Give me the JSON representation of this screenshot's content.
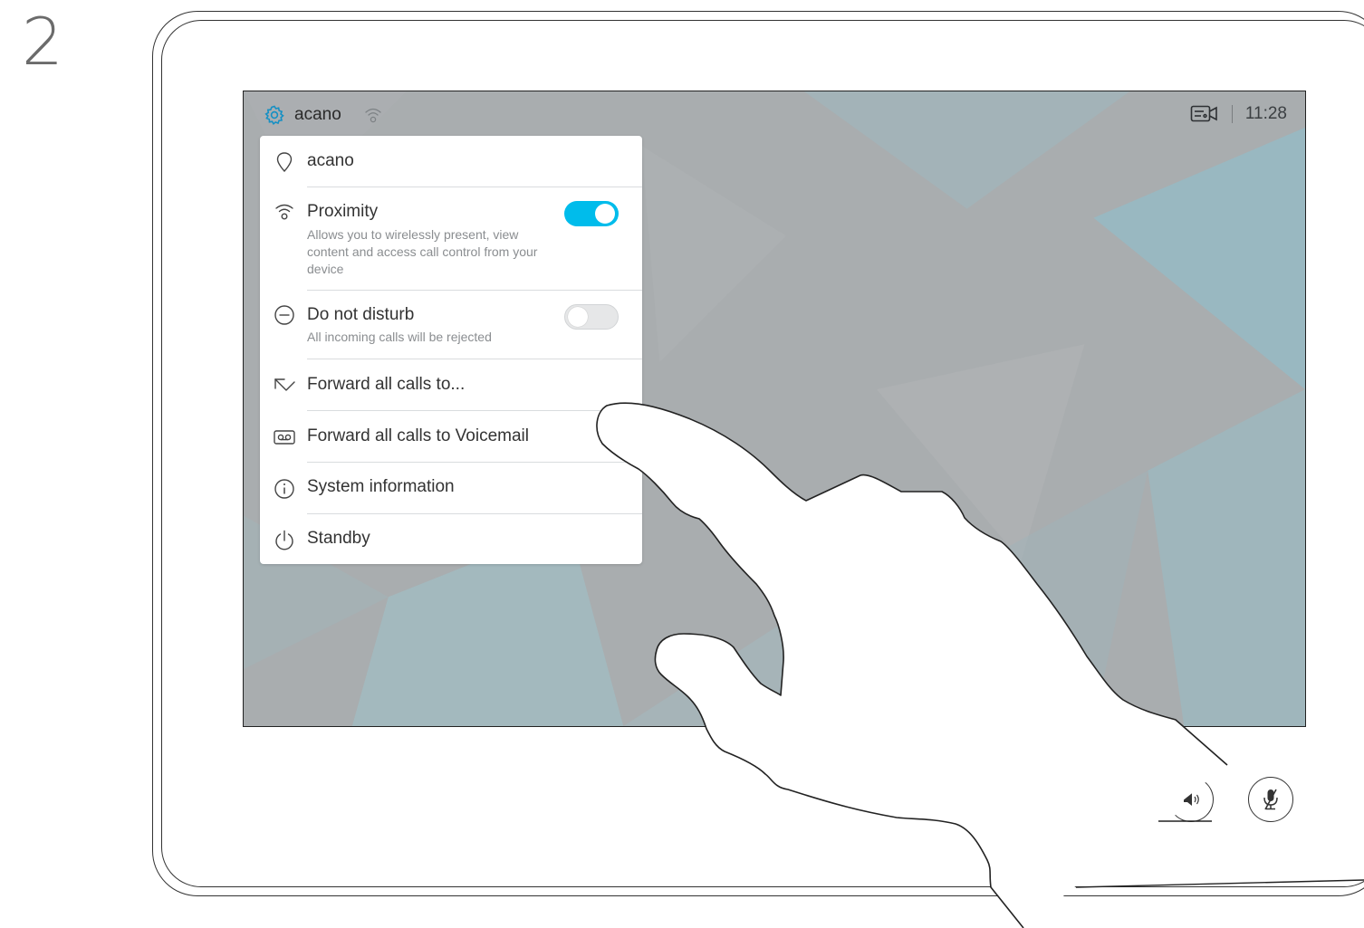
{
  "step": {
    "number": "2"
  },
  "status_bar": {
    "device_name": "acano",
    "time": "11:28",
    "settings_icon": "gear-icon",
    "proximity_icon": "wireless-icon",
    "camera_icon": "camera-status-icon"
  },
  "menu": {
    "items": [
      {
        "id": "location",
        "icon": "location-pin-icon",
        "label": "acano"
      },
      {
        "id": "proximity",
        "icon": "wireless-icon",
        "label": "Proximity",
        "description": "Allows you to wirelessly present, view content and access call control from your device",
        "toggle": true,
        "toggle_on": true
      },
      {
        "id": "do-not-disturb",
        "icon": "minus-circle-icon",
        "label": "Do not disturb",
        "description": "All incoming calls will be rejected",
        "toggle": true,
        "toggle_on": false
      },
      {
        "id": "forward-all",
        "icon": "forward-arrow-icon",
        "label": "Forward all calls to..."
      },
      {
        "id": "forward-voicemail",
        "icon": "voicemail-icon",
        "label": "Forward all calls to Voicemail"
      },
      {
        "id": "system-info",
        "icon": "info-icon",
        "label": "System information"
      },
      {
        "id": "standby",
        "icon": "power-icon",
        "label": "Standby"
      }
    ]
  },
  "controls": {
    "volume_icon": "volume-icon",
    "mute_icon": "microphone-muted-icon"
  },
  "colors": {
    "accent": "#00bceb",
    "screen_bg": "#a7abad"
  }
}
